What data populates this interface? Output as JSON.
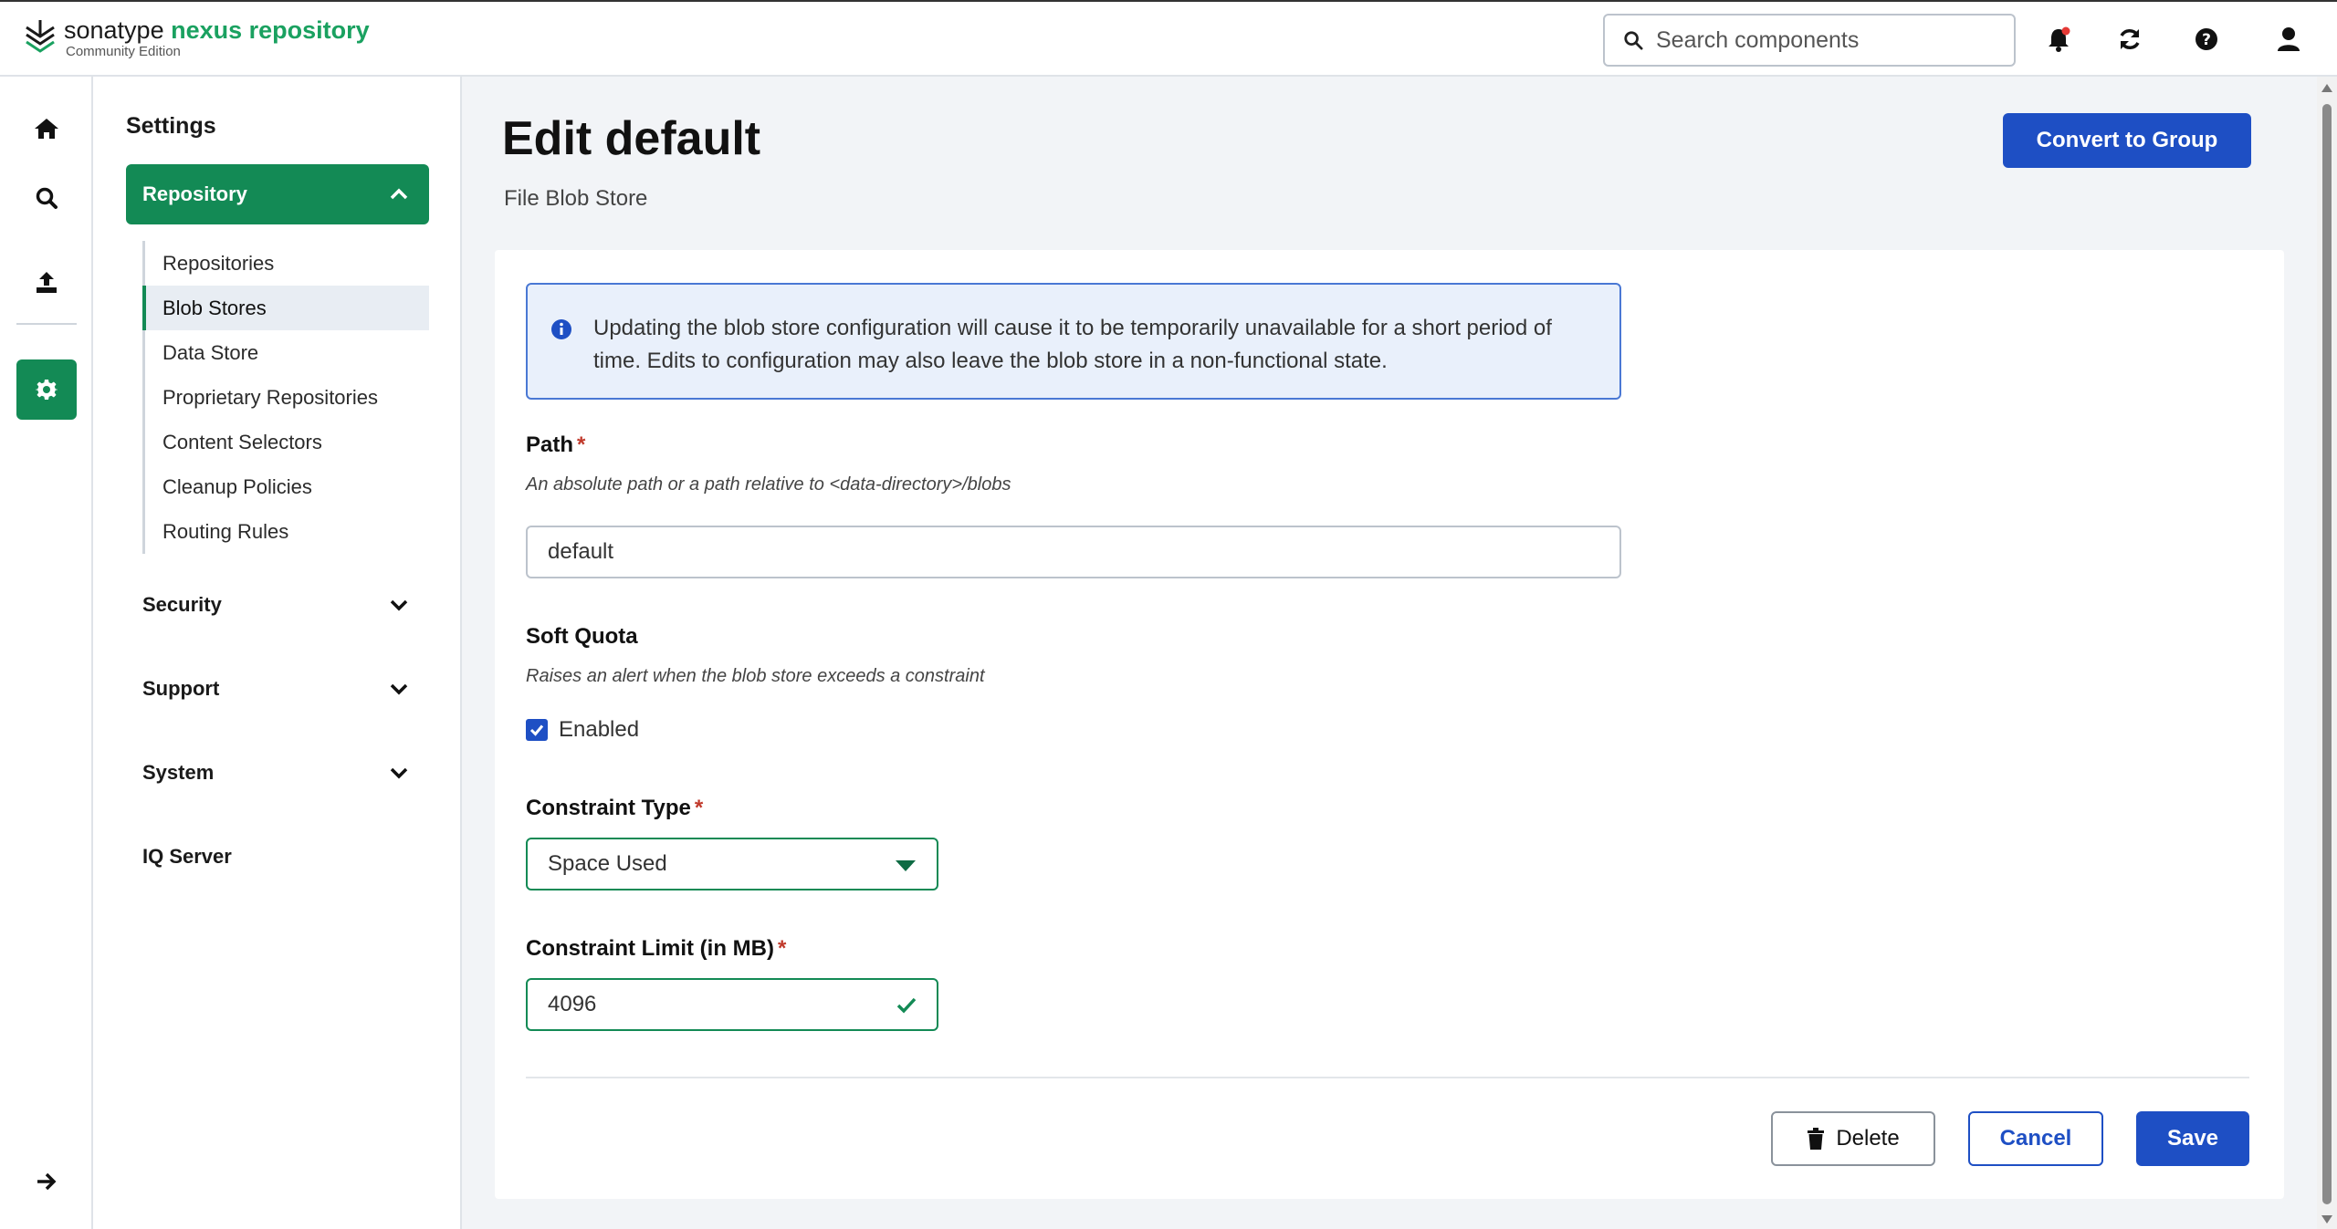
{
  "header": {
    "logo_brand": "sonatype",
    "logo_product": "nexus repository",
    "logo_edition": "Community Edition",
    "search_placeholder": "Search components",
    "icons": [
      "bell-icon",
      "refresh-icon",
      "help-icon",
      "user-icon"
    ]
  },
  "rail": {
    "items": [
      "home-icon",
      "search-icon",
      "upload-icon",
      "settings-icon",
      "expand-arrow-icon"
    ],
    "active": "settings-icon"
  },
  "sidenav": {
    "title": "Settings",
    "repository_label": "Repository",
    "repository_items": [
      {
        "label": "Repositories"
      },
      {
        "label": "Blob Stores"
      },
      {
        "label": "Data Store"
      },
      {
        "label": "Proprietary Repositories"
      },
      {
        "label": "Content Selectors"
      },
      {
        "label": "Cleanup Policies"
      },
      {
        "label": "Routing Rules"
      }
    ],
    "active_item": "Blob Stores",
    "security_label": "Security",
    "support_label": "Support",
    "system_label": "System",
    "iq_label": "IQ Server"
  },
  "page": {
    "title": "Edit default",
    "subtitle": "File Blob Store",
    "convert_label": "Convert to Group"
  },
  "form": {
    "info_text": "Updating the blob store configuration will cause it to be temporarily unavailable for a short period of time. Edits to configuration may also leave the blob store in a non-functional state.",
    "path_label": "Path",
    "path_hint": "An absolute path or a path relative to <data-directory>/blobs",
    "path_value": "default",
    "soft_quota_label": "Soft Quota",
    "soft_quota_hint": "Raises an alert when the blob store exceeds a constraint",
    "enabled_label": "Enabled",
    "enabled_checked": true,
    "constraint_type_label": "Constraint Type",
    "constraint_type_value": "Space Used",
    "constraint_limit_label": "Constraint Limit (in MB)",
    "constraint_limit_value": "4096",
    "required_mark": "*",
    "delete_label": "Delete",
    "cancel_label": "Cancel",
    "save_label": "Save"
  },
  "colors": {
    "brand_green": "#138a55",
    "primary_blue": "#1e4fc4",
    "required_red": "#c0392b"
  }
}
